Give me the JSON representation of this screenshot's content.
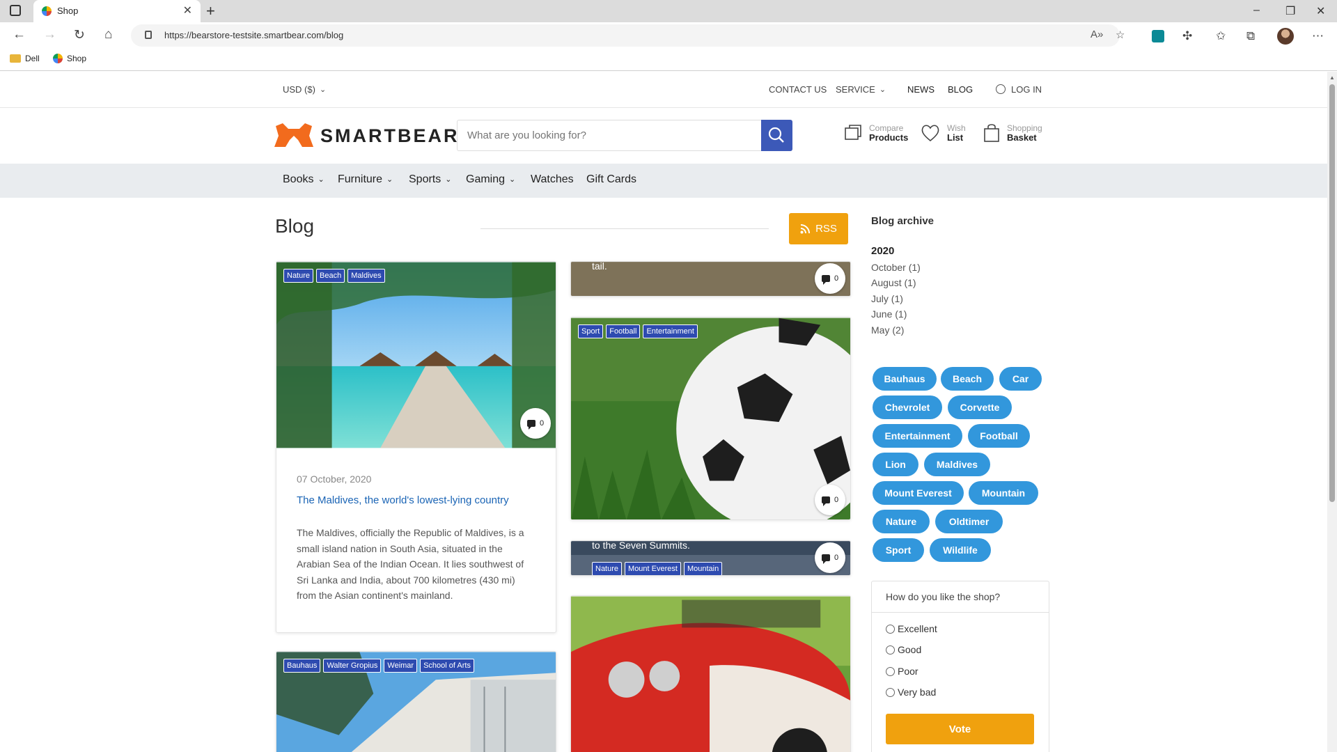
{
  "browser": {
    "tab_title": "Shop",
    "url": "https://bearstore-testsite.smartbear.com/blog",
    "bookmarks": [
      {
        "label": "Dell",
        "icon": "folder-icon"
      },
      {
        "label": "Shop",
        "icon": "shop-favicon"
      }
    ]
  },
  "topbar": {
    "currency": "USD ($)",
    "contact": "CONTACT US",
    "service": "SERVICE",
    "news": "NEWS",
    "blog": "BLOG",
    "login": "LOG IN"
  },
  "header": {
    "logo": "SMARTBEAR",
    "search_placeholder": "What are you looking for?",
    "compare": {
      "l1": "Compare",
      "l2": "Products"
    },
    "wish": {
      "l1": "Wish",
      "l2": "List"
    },
    "basket": {
      "l1": "Shopping",
      "l2": "Basket"
    }
  },
  "nav": [
    {
      "label": "Books",
      "dropdown": true
    },
    {
      "label": "Furniture",
      "dropdown": true
    },
    {
      "label": "Sports",
      "dropdown": true
    },
    {
      "label": "Gaming",
      "dropdown": true
    },
    {
      "label": "Watches",
      "dropdown": false
    },
    {
      "label": "Gift Cards",
      "dropdown": false
    }
  ],
  "blog": {
    "title": "Blog",
    "rss": "RSS",
    "posts": {
      "maldives": {
        "tags": [
          "Nature",
          "Beach",
          "Maldives"
        ],
        "comments": "0",
        "date": "07 October, 2020",
        "title": "The Maldives, the world's lowest-lying country",
        "text": "The Maldives, officially the Republic of Maldives, is a small island nation in South Asia, situated in the Arabian Sea of the Indian Ocean. It lies southwest of Sri Lanka and India, about 700 kilometres (430 mi) from the Asian continent's mainland."
      },
      "lion": {
        "overlay": "tail.",
        "comments": "0"
      },
      "football": {
        "tags": [
          "Sport",
          "Football",
          "Entertainment"
        ],
        "comments": "0"
      },
      "everest": {
        "overlay": "to the Seven Summits.",
        "tags": [
          "Nature",
          "Mount Everest",
          "Mountain"
        ],
        "comments": "0"
      },
      "bauhaus": {
        "tags": [
          "Bauhaus",
          "Walter Gropius",
          "Weimar",
          "School of Arts"
        ]
      }
    }
  },
  "sidebar": {
    "archive_title": "Blog archive",
    "year": "2020",
    "months": [
      "October (1)",
      "August (1)",
      "July (1)",
      "June (1)",
      "May (2)"
    ],
    "tags": [
      "Bauhaus",
      "Beach",
      "Car",
      "Chevrolet",
      "Corvette",
      "Entertainment",
      "Football",
      "Lion",
      "Maldives",
      "Mount Everest",
      "Mountain",
      "Nature",
      "Oldtimer",
      "Sport",
      "Wildlife"
    ],
    "poll": {
      "question": "How do you like the shop?",
      "options": [
        "Excellent",
        "Good",
        "Poor",
        "Very bad"
      ],
      "vote": "Vote"
    }
  },
  "colors": {
    "accent": "#f0a10e",
    "brand_blue": "#3c59b8",
    "tag_blue": "#3297dc",
    "logo_orange": "#f26b1d"
  }
}
